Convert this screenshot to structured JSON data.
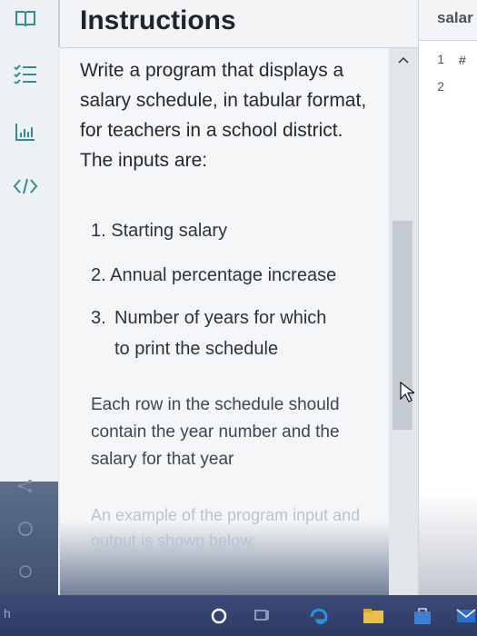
{
  "panel": {
    "title": "Instructions"
  },
  "content": {
    "intro": "Write a program that displays a salary schedule, in tabular format, for teachers in a school district. The inputs are:",
    "inputs": [
      {
        "num": "1.",
        "text": "Starting salary"
      },
      {
        "num": "2.",
        "text": "Annual percentage increase"
      },
      {
        "num": "3.",
        "text": "Number of years for which to print the schedule"
      }
    ],
    "row_note": "Each row in the schedule should contain the year number and the salary for that year",
    "example_note": "An example of the program input and output is shown below:"
  },
  "editor": {
    "file_name": "salar",
    "line_numbers": [
      "1",
      "2"
    ],
    "line1_code": "#"
  },
  "taskbar": {
    "left_label": "h"
  },
  "colors": {
    "accent_teal": "#2f8f91",
    "taskbar": "#2c3a63"
  }
}
